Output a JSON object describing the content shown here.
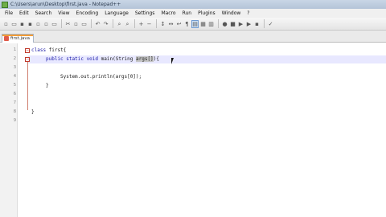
{
  "window": {
    "title": "C:\\Users\\arun\\Desktop\\first.java - Notepad++"
  },
  "menu": [
    "File",
    "Edit",
    "Search",
    "View",
    "Encoding",
    "Language",
    "Settings",
    "Macro",
    "Run",
    "Plugins",
    "Window",
    "?"
  ],
  "tab": {
    "label": "first.java"
  },
  "line_numbers": [
    "1",
    "2",
    "3",
    "4",
    "5",
    "6",
    "7",
    "8",
    "9"
  ],
  "code": {
    "line1_kw": "class",
    "line1_rest": " first{",
    "line2_kw": "public static void",
    "line2_rest": " main(String ",
    "line2_sel": "args[]",
    "line2_end": "){",
    "line4": "System.out.println(args[0]);",
    "line5": "}",
    "line8": "}"
  }
}
